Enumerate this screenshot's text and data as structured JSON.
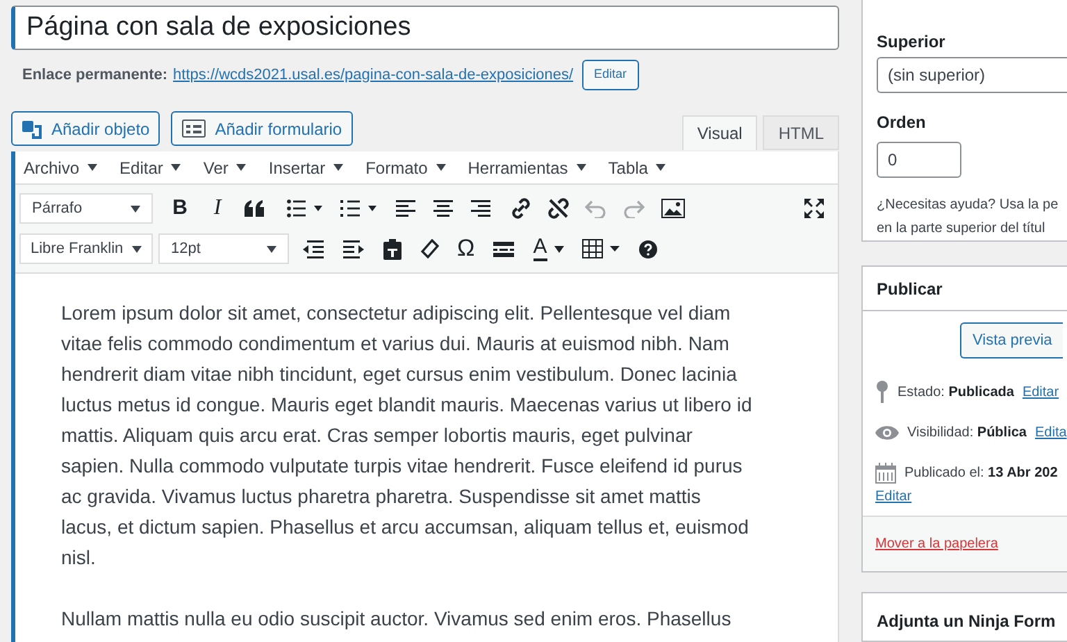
{
  "title_field": {
    "value": "Página con sala de exposiciones"
  },
  "permalink": {
    "label": "Enlace permanente:",
    "url": "https://wcds2021.usal.es/pagina-con-sala-de-exposiciones/",
    "edit_button": "Editar"
  },
  "media_buttons": [
    "Añadir objeto",
    "Añadir formulario"
  ],
  "editor_tabs": [
    {
      "label": "Visual",
      "selected": true
    },
    {
      "label": "HTML",
      "selected": false
    }
  ],
  "menu_bar": [
    "Archivo",
    "Editar",
    "Ver",
    "Insertar",
    "Formato",
    "Herramientas",
    "Tabla"
  ],
  "toolbar": {
    "format_select": "Párrafo",
    "bold": "B",
    "italic": "I",
    "font_select": "Libre Franklin",
    "size_select": "12pt",
    "omega": "Ω",
    "text_color": "A",
    "undo_disabled": true,
    "redo_disabled": true
  },
  "content": [
    "Lorem ipsum dolor sit amet, consectetur adipiscing elit. Pellentesque vel diam vitae felis commodo condimentum et varius dui. Mauris at euismod nibh. Nam hendrerit diam vitae nibh tincidunt, eget cursus enim vestibulum. Donec lacinia luctus metus id congue. Mauris eget blandit mauris. Maecenas varius ut libero id mattis. Aliquam quis arcu erat. Cras semper lobortis mauris, eget pulvinar sapien. Nulla commodo vulputate turpis vitae hendrerit. Fusce eleifend id purus ac gravida. Vivamus luctus pharetra pharetra. Suspendisse sit amet mattis lacus, et dictum sapien. Phasellus et arcu accumsan, aliquam tellus et, euismod nisl.",
    "Nullam mattis nulla eu odio suscipit auctor. Vivamus sed enim eros. Phasellus"
  ],
  "page_attributes": {
    "parent_label": "Superior",
    "parent_value": "(sin superior)",
    "order_label": "Orden",
    "order_value": "0",
    "help_lines": [
      "¿Necesitas ayuda? Usa la pe",
      "en la parte superior del títul"
    ]
  },
  "publish": {
    "title": "Publicar",
    "preview_button": "Vista previa",
    "rows": [
      {
        "kind": "status",
        "label": "Estado:",
        "value": "Publicada",
        "link": "Editar"
      },
      {
        "kind": "visibility",
        "label": "Visibilidad:",
        "value": "Pública",
        "link": "Edita"
      },
      {
        "kind": "date",
        "label": "Publicado el:",
        "value": "13 Abr 202",
        "link": "Editar"
      }
    ],
    "trash_link": "Mover a la papelera"
  },
  "ninja_panel": {
    "title": "Adjunta un Ninja Form"
  }
}
